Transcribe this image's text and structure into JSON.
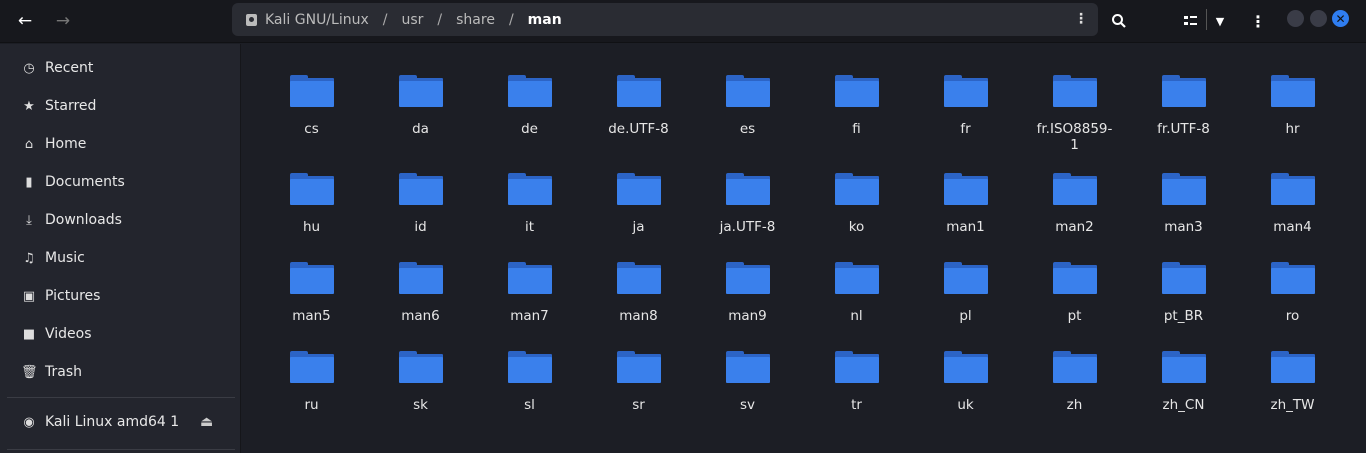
{
  "nav": {
    "back": "←",
    "forward": "→"
  },
  "path": {
    "root": "Kali GNU/Linux",
    "segments": [
      "usr",
      "share"
    ],
    "current": "man",
    "separator": "/"
  },
  "toolbar": {
    "search_icon": "search-icon",
    "view_icon": "list-view-icon",
    "menu_icon": "kebab-menu-icon"
  },
  "colors": {
    "accent": "#3a80ec",
    "close": "#2f7df0"
  },
  "sidebar": {
    "items": [
      {
        "label": "Recent",
        "icon": "◷"
      },
      {
        "label": "Starred",
        "icon": "★"
      },
      {
        "label": "Home",
        "icon": "⌂"
      },
      {
        "label": "Documents",
        "icon": "▮"
      },
      {
        "label": "Downloads",
        "icon": "⤓"
      },
      {
        "label": "Music",
        "icon": "♫"
      },
      {
        "label": "Pictures",
        "icon": "▣"
      },
      {
        "label": "Videos",
        "icon": "■"
      },
      {
        "label": "Trash",
        "icon": "🗑"
      }
    ],
    "devices": [
      {
        "label": "Kali Linux amd64 1",
        "icon": "◉",
        "eject": "⏏"
      }
    ]
  },
  "folders": [
    "cs",
    "da",
    "de",
    "de.UTF-8",
    "es",
    "fi",
    "fr",
    "fr.ISO8859-1",
    "fr.UTF-8",
    "hr",
    "hu",
    "id",
    "it",
    "ja",
    "ja.UTF-8",
    "ko",
    "man1",
    "man2",
    "man3",
    "man4",
    "man5",
    "man6",
    "man7",
    "man8",
    "man9",
    "nl",
    "pl",
    "pt",
    "pt_BR",
    "ro",
    "ru",
    "sk",
    "sl",
    "sr",
    "sv",
    "tr",
    "uk",
    "zh",
    "zh_CN",
    "zh_TW"
  ]
}
